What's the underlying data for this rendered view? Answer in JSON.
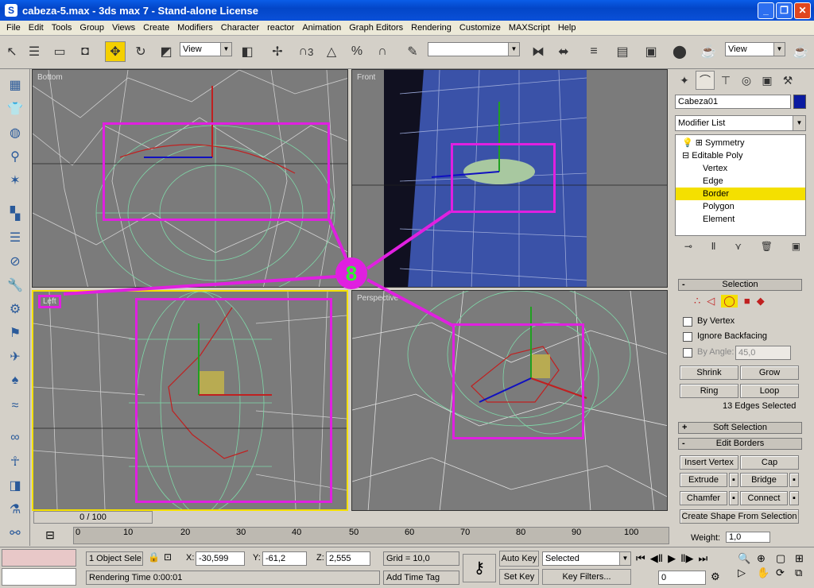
{
  "window": {
    "title": "cabeza-5.max - 3ds max 7 - Stand-alone License"
  },
  "menu": [
    "File",
    "Edit",
    "Tools",
    "Group",
    "Views",
    "Create",
    "Modifiers",
    "Character",
    "reactor",
    "Animation",
    "Graph Editors",
    "Rendering",
    "Customize",
    "MAXScript",
    "Help"
  ],
  "toolbar": {
    "refcoord": "View",
    "refcoord2": "View",
    "spinner3": "3",
    "named_selection": ""
  },
  "viewports": {
    "bottom": "Bottom",
    "front": "Front",
    "left": "Left",
    "perspective": "Perspective"
  },
  "annotation": {
    "number": "8"
  },
  "command_panel": {
    "object_name": "Cabeza01",
    "object_color": "#0a1aa0",
    "modifier_list": "Modifier List",
    "stack": {
      "symmetry": "Symmetry",
      "editable_poly": "Editable Poly",
      "vertex": "Vertex",
      "edge": "Edge",
      "border": "Border",
      "polygon": "Polygon",
      "element": "Element"
    },
    "selection": {
      "title": "Selection",
      "by_vertex": "By Vertex",
      "ignore_backfacing": "Ignore Backfacing",
      "by_angle": "By Angle:",
      "angle_value": "45,0",
      "shrink": "Shrink",
      "grow": "Grow",
      "ring": "Ring",
      "loop": "Loop",
      "status": "13 Edges Selected"
    },
    "soft_selection": "Soft Selection",
    "edit_borders": {
      "title": "Edit Borders",
      "insert_vertex": "Insert Vertex",
      "cap": "Cap",
      "extrude": "Extrude",
      "bridge": "Bridge",
      "chamfer": "Chamfer",
      "connect": "Connect",
      "create_shape": "Create Shape From Selection",
      "weight": "Weight:",
      "weight_value": "1,0"
    }
  },
  "timeline": {
    "slider": "0 / 100",
    "ticks": [
      "0",
      "10",
      "20",
      "30",
      "40",
      "50",
      "60",
      "70",
      "80",
      "90",
      "100"
    ]
  },
  "status": {
    "selection": "1 Object Sele",
    "x_label": "X:",
    "x": "-30,599",
    "y_label": "Y:",
    "y": "-61,2",
    "z_label": "Z:",
    "z": "2,555",
    "grid": "Grid = 10,0",
    "auto_key": "Auto Key",
    "set_key": "Set Key",
    "selected": "Selected",
    "key_filters": "Key Filters...",
    "rendering_time": "Rendering Time  0:00:01",
    "add_time_tag": "Add Time Tag",
    "frame": "0"
  }
}
